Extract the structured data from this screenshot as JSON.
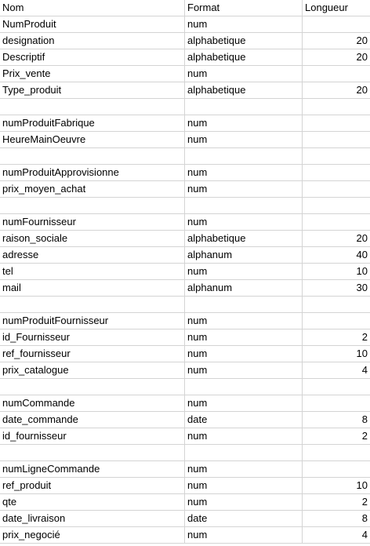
{
  "header": {
    "nom": "Nom",
    "format": "Format",
    "longueur": "Longueur"
  },
  "rows": [
    {
      "nom": "NumProduit",
      "format": "num",
      "longueur": ""
    },
    {
      "nom": "designation",
      "format": "alphabetique",
      "longueur": "20"
    },
    {
      "nom": "Descriptif",
      "format": "alphabetique",
      "longueur": "20"
    },
    {
      "nom": "Prix_vente",
      "format": "num",
      "longueur": ""
    },
    {
      "nom": "Type_produit",
      "format": "alphabetique",
      "longueur": "20"
    },
    {
      "nom": "",
      "format": "",
      "longueur": ""
    },
    {
      "nom": "numProduitFabrique",
      "format": "num",
      "longueur": ""
    },
    {
      "nom": "HeureMainOeuvre",
      "format": "num",
      "longueur": ""
    },
    {
      "nom": "",
      "format": "",
      "longueur": ""
    },
    {
      "nom": "numProduitApprovisionne",
      "format": "num",
      "longueur": ""
    },
    {
      "nom": "prix_moyen_achat",
      "format": "num",
      "longueur": ""
    },
    {
      "nom": "",
      "format": "",
      "longueur": ""
    },
    {
      "nom": "numFournisseur",
      "format": "num",
      "longueur": ""
    },
    {
      "nom": "raison_sociale",
      "format": "alphabetique",
      "longueur": "20"
    },
    {
      "nom": "adresse",
      "format": "alphanum",
      "longueur": "40"
    },
    {
      "nom": "tel",
      "format": "num",
      "longueur": "10"
    },
    {
      "nom": "mail",
      "format": "alphanum",
      "longueur": "30"
    },
    {
      "nom": "",
      "format": "",
      "longueur": ""
    },
    {
      "nom": "numProduitFournisseur",
      "format": "num",
      "longueur": ""
    },
    {
      "nom": "id_Fournisseur",
      "format": "num",
      "longueur": "2"
    },
    {
      "nom": "ref_fournisseur",
      "format": "num",
      "longueur": "10"
    },
    {
      "nom": "prix_catalogue",
      "format": "num",
      "longueur": "4"
    },
    {
      "nom": "",
      "format": "",
      "longueur": ""
    },
    {
      "nom": "numCommande",
      "format": "num",
      "longueur": ""
    },
    {
      "nom": "date_commande",
      "format": "date",
      "longueur": "8"
    },
    {
      "nom": "id_fournisseur",
      "format": "num",
      "longueur": "2"
    },
    {
      "nom": "",
      "format": "",
      "longueur": ""
    },
    {
      "nom": "numLigneCommande",
      "format": "num",
      "longueur": ""
    },
    {
      "nom": "ref_produit",
      "format": "num",
      "longueur": "10"
    },
    {
      "nom": "qte",
      "format": "num",
      "longueur": "2"
    },
    {
      "nom": "date_livraison",
      "format": "date",
      "longueur": "8"
    },
    {
      "nom": "prix_negocié",
      "format": "num",
      "longueur": "4"
    }
  ]
}
